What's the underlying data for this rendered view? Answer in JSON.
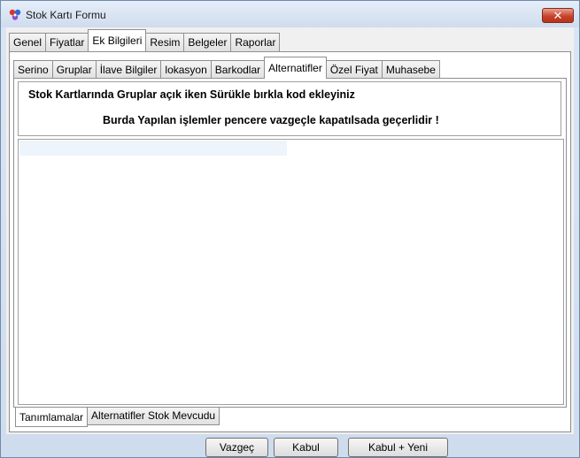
{
  "window": {
    "title": "Stok Kartı Formu",
    "close_label": "✕"
  },
  "top_tabs": [
    "Genel",
    "Fiyatlar",
    "Ek Bilgileri",
    "Resim",
    "Belgeler",
    "Raporlar"
  ],
  "sub_tabs": [
    "Serino",
    "Gruplar",
    "İlave Bilgiler",
    "lokasyon",
    "Barkodlar",
    "Alternatifler",
    "Özel Fiyat",
    "Muhasebe"
  ],
  "info": {
    "line1": "Stok Kartlarında Gruplar açık iken Sürükle bırkla kod ekleyiniz",
    "line2": "Burda Yapılan işlemler pencere vazgeçle kapatılsada geçerlidir !"
  },
  "bottom_tabs": [
    "Tanımlamalar",
    "Alternatifler Stok Mevcudu"
  ],
  "buttons": {
    "cancel": "Vazgeç",
    "accept": "Kabul",
    "accept_new": "Kabul + Yeni"
  },
  "colors": {
    "close_button": "#c7432c",
    "list_highlight": "#eef4fb"
  },
  "icons": {
    "app": "stok-app-icon",
    "close": "close-icon"
  }
}
